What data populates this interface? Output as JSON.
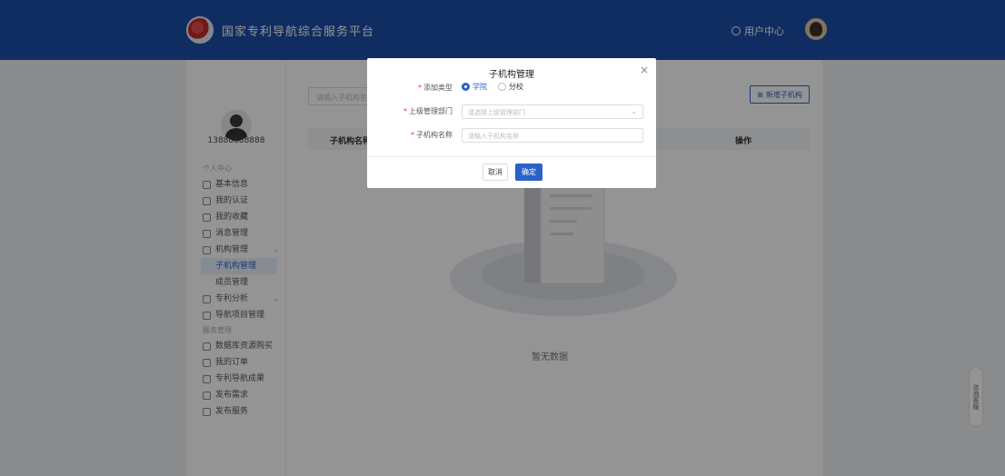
{
  "header": {
    "site_title": "国家专利导航综合服务平台",
    "user_center": "用户中心"
  },
  "sidebar": {
    "profile_id": "13888888888",
    "group1": "个人中心",
    "items1": [
      {
        "label": "基本信息",
        "icon": "info-icon"
      },
      {
        "label": "我的认证",
        "icon": "verify-icon"
      },
      {
        "label": "我的收藏",
        "icon": "star-icon"
      },
      {
        "label": "消息管理",
        "icon": "message-icon"
      },
      {
        "label": "机构管理",
        "icon": "org-icon",
        "arrow": "⌄"
      }
    ],
    "sub_items": [
      "子机构管理",
      "成员管理"
    ],
    "items2": [
      {
        "label": "专利分析",
        "icon": "analysis-icon",
        "arrow": "⌄"
      },
      {
        "label": "导航项目管理",
        "icon": "project-icon"
      }
    ],
    "group2": "服务管理",
    "items3": [
      {
        "label": "数据库资源购买",
        "icon": "database-icon"
      },
      {
        "label": "我的订单",
        "icon": "order-icon"
      },
      {
        "label": "专利导航成果",
        "icon": "result-icon"
      },
      {
        "label": "发布需求",
        "icon": "publish-icon"
      },
      {
        "label": "发布服务",
        "icon": "service-icon"
      }
    ]
  },
  "content": {
    "search_placeholder": "请输入子机构名称",
    "add_button": "新增子机构",
    "col_name": "子机构名称",
    "col_op": "操作",
    "empty_text": "暂无数据"
  },
  "modal": {
    "title": "子机构管理",
    "close": "×",
    "type_label": "添加类型",
    "type_options": [
      "学院",
      "分校"
    ],
    "parent_label": "上级管理部门",
    "parent_placeholder": "请选择上级管理部门",
    "name_label": "子机构名称",
    "name_placeholder": "请输入子机构名称",
    "cancel": "取消",
    "ok": "确定"
  },
  "float_widget": "咨询客服"
}
